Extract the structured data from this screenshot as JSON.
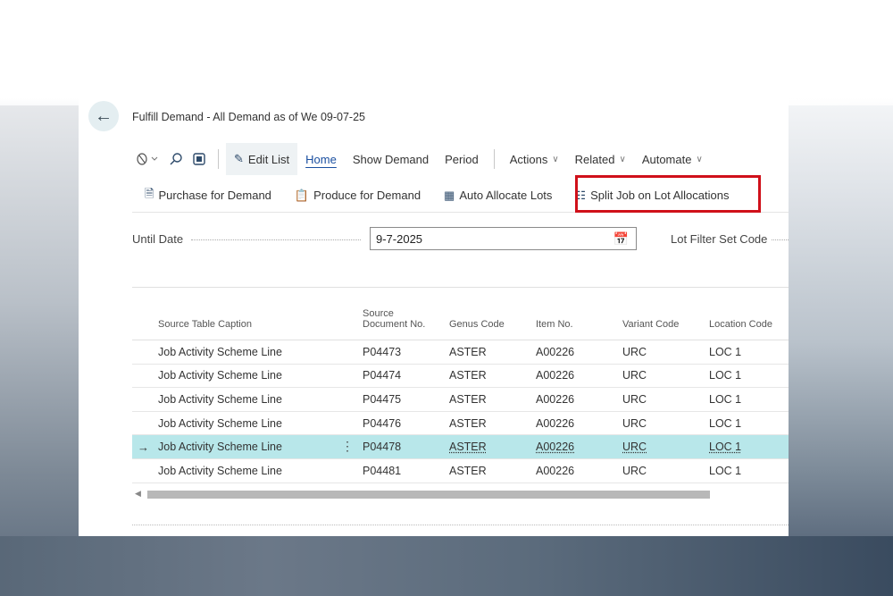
{
  "page": {
    "title": "Fulfill Demand - All Demand as of We 09-07-25"
  },
  "actionbar": {
    "edit_list": "Edit List",
    "home": "Home",
    "show_demand": "Show Demand",
    "period": "Period",
    "actions": "Actions",
    "related": "Related",
    "automate": "Automate"
  },
  "promoted": {
    "purchase": "Purchase for Demand",
    "produce": "Produce for Demand",
    "auto_allocate": "Auto Allocate Lots",
    "split_job": "Split Job on Lot Allocations"
  },
  "filter": {
    "until_date_label": "Until Date",
    "until_date_value": "9-7-2025",
    "lot_filter_label": "Lot Filter Set Code"
  },
  "table": {
    "headers": {
      "source_table_caption": "Source Table Caption",
      "source_doc_line1": "Source",
      "source_doc_line2": "Document No.",
      "genus_code": "Genus Code",
      "item_no": "Item No.",
      "variant_code": "Variant Code",
      "location_code": "Location Code"
    },
    "rows": [
      {
        "caption": "Job Activity Scheme Line",
        "doc": "P04473",
        "genus": "ASTER",
        "item": "A00226",
        "variant": "URC",
        "location": "LOC 1"
      },
      {
        "caption": "Job Activity Scheme Line",
        "doc": "P04474",
        "genus": "ASTER",
        "item": "A00226",
        "variant": "URC",
        "location": "LOC 1"
      },
      {
        "caption": "Job Activity Scheme Line",
        "doc": "P04475",
        "genus": "ASTER",
        "item": "A00226",
        "variant": "URC",
        "location": "LOC 1"
      },
      {
        "caption": "Job Activity Scheme Line",
        "doc": "P04476",
        "genus": "ASTER",
        "item": "A00226",
        "variant": "URC",
        "location": "LOC 1"
      },
      {
        "caption": "Job Activity Scheme Line",
        "doc": "P04478",
        "genus": "ASTER",
        "item": "A00226",
        "variant": "URC",
        "location": "LOC 1"
      },
      {
        "caption": "Job Activity Scheme Line",
        "doc": "P04481",
        "genus": "ASTER",
        "item": "A00226",
        "variant": "URC",
        "location": "LOC 1"
      }
    ],
    "selected_row_marker": "→"
  },
  "colors": {
    "accent": "#1a4fa0",
    "selected_row": "#b8e7ea",
    "highlight": "#d0101a"
  }
}
